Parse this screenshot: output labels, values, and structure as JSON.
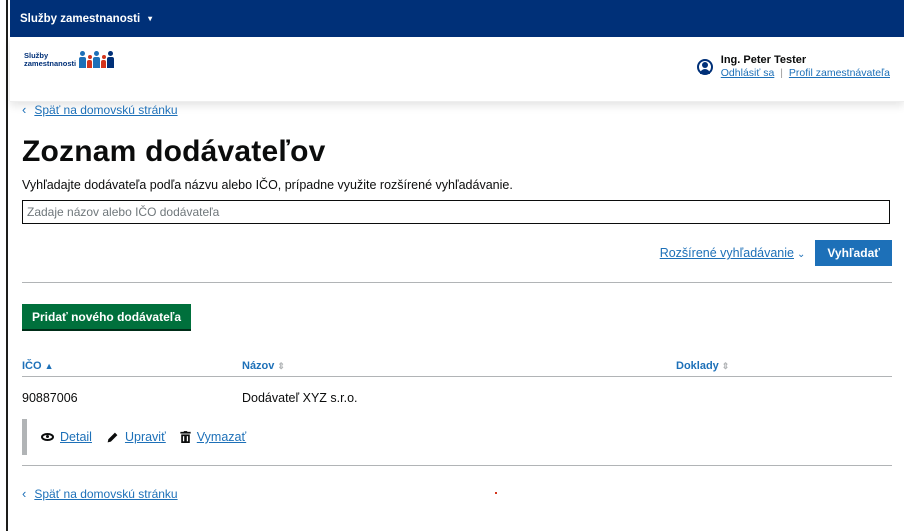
{
  "topbar": {
    "title": "Služby zamestnanosti",
    "caret": "▾"
  },
  "logo": {
    "line1": "Služby",
    "line2": "zamestnanosti"
  },
  "user": {
    "name": "Ing. Peter Tester",
    "logout": "Odhlásiť sa",
    "separator": "|",
    "profile": "Profil zamestnávateľa"
  },
  "nav": {
    "back_chevron": "‹",
    "back_label": "Späť na domovskú stránku"
  },
  "page": {
    "title": "Zoznam dodávateľov",
    "lead": "Vyhľadajte dodávateľa podľa názvu alebo IČO, prípadne využite rozšírené vyhľadávanie."
  },
  "search": {
    "placeholder": "Zadaje názov alebo IČO dodávateľa",
    "value": "",
    "advanced_label": "Rozšírené vyhľadávanie",
    "advanced_chevron": "⌄",
    "button_label": "Vyhľadať"
  },
  "add_button": {
    "label": "Pridať nového dodávateľa"
  },
  "table": {
    "columns": [
      {
        "label": "IČO",
        "sort": "▲"
      },
      {
        "label": "Názov",
        "sort": "⇕"
      },
      {
        "label": "Doklady",
        "sort": "⇕"
      }
    ],
    "rows": [
      {
        "ico": "90887006",
        "nazov": "Dodávateľ XYZ s.r.o.",
        "doklady": ""
      }
    ],
    "row_actions": [
      {
        "label": "Detail",
        "icon": "eye-icon"
      },
      {
        "label": "Upraviť",
        "icon": "pencil-icon"
      },
      {
        "label": "Vymazať",
        "icon": "trash-icon"
      }
    ]
  },
  "colors": {
    "primary": "#003078",
    "link": "#1d70b8",
    "success": "#00703c",
    "text": "#0b0c0c",
    "border": "#b1b4b6"
  }
}
